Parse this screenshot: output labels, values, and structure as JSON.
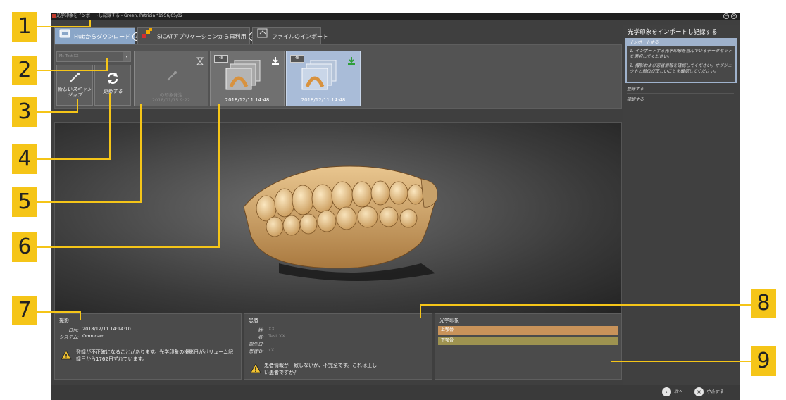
{
  "window": {
    "title": "光学印象をインポートし記録する - Green, Patricia *1956/05/02"
  },
  "tabs": [
    {
      "label": "Hubからダウンロード",
      "badge": "3"
    },
    {
      "label": "SICATアプリケーションから再利用",
      "badge": "1"
    },
    {
      "label": "ファイルのインポート"
    }
  ],
  "toolbar": {
    "select_value": "Mr. Test XX",
    "new_scan_label": "新しいスキャンジョブ",
    "refresh_label": "更新する"
  },
  "thumbs": [
    {
      "label": "の印象発注",
      "date": "2018/01/15 9:22"
    },
    {
      "date": "2018/12/11 14:48",
      "badge": "4B"
    },
    {
      "date": "2018/12/11 14:48",
      "badge": "4B"
    }
  ],
  "capture": {
    "heading": "撮影",
    "date_label": "日付:",
    "date_value": "2018/12/11 14:14:10",
    "system_label": "システム:",
    "system_value": "Omnicam",
    "warning": "登録が不正確になることがあります。光学印象の撮影日がボリューム記録日から1762日ずれています。"
  },
  "patient": {
    "heading": "患者",
    "last_label": "姓:",
    "first_label": "名:",
    "birth_label": "誕生日:",
    "id_label": "患者ID:",
    "last_value": "XX",
    "first_value": "Test XX",
    "id_value": "xX",
    "warning": "患者情報が一致しないか、不完全です。これは正しい患者ですか？"
  },
  "impressions": {
    "heading": "光学印象",
    "upper": "上顎骨",
    "lower": "下顎骨",
    "upper_color": "#c9935a",
    "lower_color": "#9e9350"
  },
  "sidebar": {
    "title": "光学印象をインポートし記録する",
    "step1_title": "インポートする",
    "step1_line1": "1. インポートする光学印象を含んでいるデータセットを選択してください。",
    "step1_line2": "2. 撮影および患者情報を確認してください。オブジェクトと部位が正しいことを確認してください。",
    "step2": "登録する",
    "step3": "確認する"
  },
  "footer": {
    "next_label": "次へ",
    "cancel_label": "中止する"
  },
  "callouts": [
    "1",
    "2",
    "3",
    "4",
    "5",
    "6",
    "7",
    "8",
    "9"
  ],
  "colors": {
    "callout": "#f5c518",
    "active_tab": "#8aa6c8",
    "selected_thumb": "#a9bcd8",
    "step_active": "#9fb2cc"
  }
}
